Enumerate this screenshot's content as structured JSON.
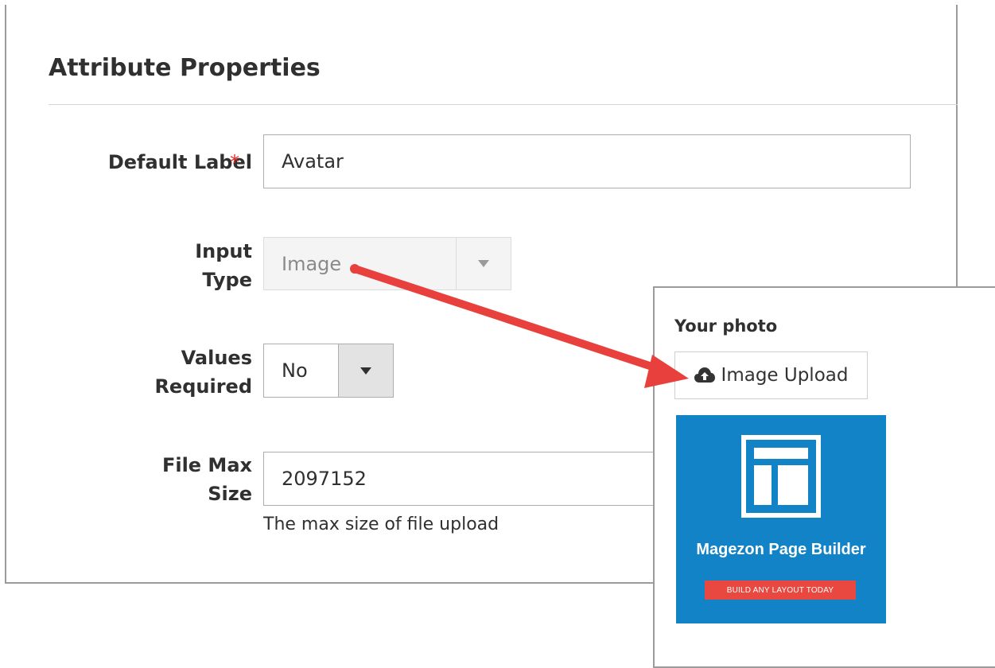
{
  "section": {
    "title": "Attribute Properties"
  },
  "fields": {
    "default_label": {
      "label": "Default Label",
      "required_mark": "*",
      "value": "Avatar"
    },
    "input_type": {
      "label_line1": "Input",
      "label_line2": "Type",
      "value": "Image",
      "disabled": true
    },
    "values_required": {
      "label_line1": "Values",
      "label_line2": "Required",
      "value": "No"
    },
    "file_max_size": {
      "label_line1": "File Max",
      "label_line2": "Size",
      "value": "2097152",
      "note": "The max size of file upload"
    }
  },
  "preview": {
    "title": "Your photo",
    "upload_label": "Image Upload",
    "upload_icon": "cloud-upload-icon",
    "promo": {
      "logo_icon": "page-layout-icon",
      "title": "Magezon Page Builder",
      "cta": "BUILD ANY LAYOUT TODAY",
      "bg_color": "#1283c7",
      "cta_color": "#e8483f"
    }
  },
  "colors": {
    "required_star": "#e22626",
    "annotation_arrow": "#e8413d"
  }
}
